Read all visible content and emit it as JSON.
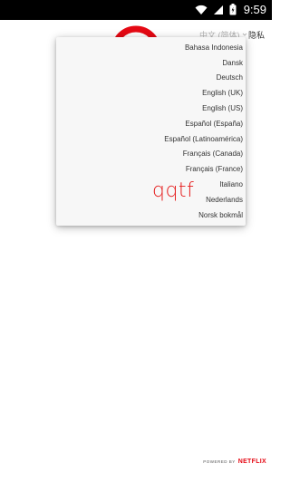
{
  "status_bar": {
    "time": "9:59",
    "icons": [
      "wifi-icon",
      "cellular-signal-icon",
      "battery-icon"
    ]
  },
  "header": {
    "language_selector": {
      "selected": "中文 (简体)",
      "icon": "chevron-down-icon"
    },
    "privacy_link": "隐私"
  },
  "language_menu": {
    "items": [
      "Bahasa Indonesia",
      "Dansk",
      "Deutsch",
      "English (UK)",
      "English (US)",
      "Español (España)",
      "Español (Latinoamérica)",
      "Français (Canada)",
      "Français (France)",
      "Italiano",
      "Nederlands",
      "Norsk bokmål"
    ]
  },
  "overlay": {
    "text": "qqtf"
  },
  "footer": {
    "powered_by": "POWERED BY",
    "brand": "NETFLIX"
  },
  "colors": {
    "brand_red": "#e50914",
    "overlay_red": "#e51a1a",
    "menu_bg": "#f7f7f7",
    "status_bar_bg": "#000000"
  }
}
